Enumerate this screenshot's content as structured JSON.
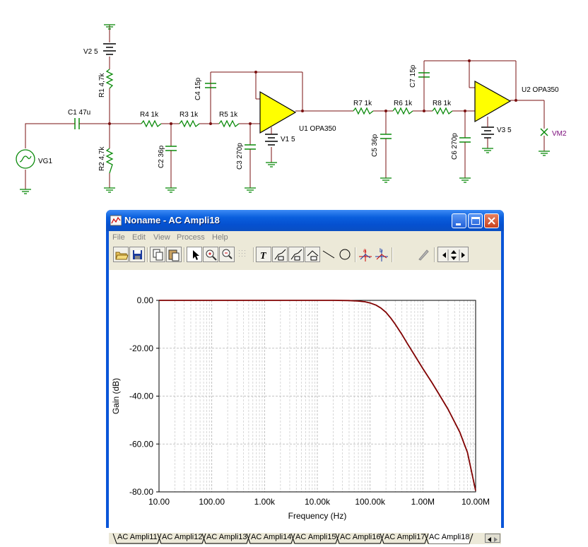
{
  "schematic": {
    "labels": {
      "v2": "V2 5",
      "r1": "R1 4,7k",
      "c1": "C1 47u",
      "r2": "R2 4,7k",
      "vg1": "VG1",
      "r4": "R4 1k",
      "r3": "R3 1k",
      "r5": "R5 1k",
      "c4": "C4 15p",
      "c2": "C2 36p",
      "c3": "C3 270p",
      "u1": "U1 OPA350",
      "v1": "V1 5",
      "r7": "R7 1k",
      "r6": "R6 1k",
      "r8": "R8 1k",
      "c7": "C7 15p",
      "c5": "C5 36p",
      "c6": "C6 270p",
      "u2": "U2 OPA350",
      "v3": "V3 5",
      "vm2": "VM2"
    }
  },
  "window": {
    "title": "Noname - AC Ampli18",
    "menu": [
      "File",
      "Edit",
      "View",
      "Process",
      "Help"
    ],
    "toolbar_icons": [
      "open-folder-icon",
      "save-icon",
      "copy-icon",
      "paste-icon",
      "pointer-icon",
      "zoom-in-icon",
      "zoom-100-icon",
      "grid-icon",
      "text-icon",
      "annotate-icon",
      "annotate2-icon",
      "annotate3-icon",
      "line-icon",
      "circle-icon",
      "cursor-a-icon",
      "cursor-b-icon",
      "blank-icon",
      "pen-icon",
      "arrows-icon"
    ],
    "tabs": [
      "AC Ampli11",
      "AC Ampli12",
      "AC Ampli13",
      "AC Ampli14",
      "AC Ampli15",
      "AC Ampli16",
      "AC Ampli17",
      "AC Ampli18"
    ],
    "active_tab": "AC Ampli18"
  },
  "chart_data": {
    "type": "line",
    "title": "",
    "xlabel": "Frequency (Hz)",
    "ylabel": "Gain (dB)",
    "x_scale": "log",
    "xlim": [
      10,
      10000000
    ],
    "ylim": [
      -80,
      0
    ],
    "x_ticks": [
      "10.00",
      "100.00",
      "1.00k",
      "10.00k",
      "100.00k",
      "1.00M",
      "10.00M"
    ],
    "y_ticks": [
      "0.00",
      "-20.00",
      "-40.00",
      "-60.00",
      "-80.00"
    ],
    "grid": true,
    "line_color": "#800000",
    "series": [
      {
        "x": [
          10,
          100,
          1000,
          10000,
          20000,
          40000,
          60000,
          80000,
          100000,
          130000,
          160000,
          200000,
          250000,
          300000,
          400000,
          500000,
          700000,
          1000000,
          1500000,
          2000000,
          3000000,
          5000000,
          7000000,
          10000000
        ],
        "y": [
          0,
          0,
          0,
          0,
          0,
          -0.1,
          -0.3,
          -0.6,
          -1.1,
          -2.0,
          -3.2,
          -5.0,
          -7.6,
          -10.0,
          -14.2,
          -17.8,
          -23.0,
          -28.5,
          -34.5,
          -39.0,
          -45.5,
          -55.0,
          -63.5,
          -79.5
        ]
      }
    ]
  }
}
